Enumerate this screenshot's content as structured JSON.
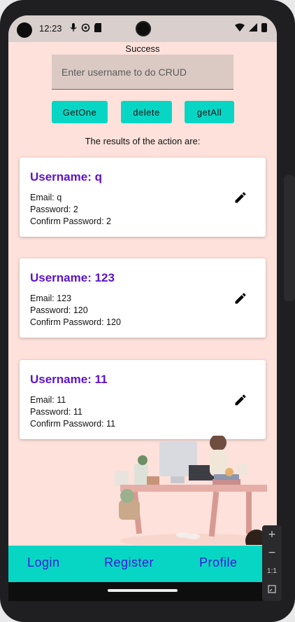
{
  "status_bar": {
    "time": "12:23"
  },
  "message": "Success",
  "search": {
    "placeholder": "Enter username to do CRUD",
    "value": ""
  },
  "actions": {
    "get_one": "GetOne",
    "delete": "delete",
    "get_all": "getAll"
  },
  "results_title": "The results of the action are:",
  "users": [
    {
      "username": "Username: q",
      "email": "Email: q",
      "password": "Password: 2",
      "confirm": "Confirm Password: 2"
    },
    {
      "username": "Username: 123",
      "email": "Email: 123",
      "password": "Password: 120",
      "confirm": "Confirm Password: 120"
    },
    {
      "username": "Username: 11",
      "email": "Email: 11",
      "password": "Password: 11",
      "confirm": "Confirm Password: 11"
    }
  ],
  "bottom_nav": {
    "login": "Login",
    "register": "Register",
    "profile": "Profile"
  },
  "zoom_controls": {
    "zoom_in": "+",
    "zoom_out": "−",
    "actual_size": "1:1"
  },
  "colors": {
    "accent": "#08d6c5",
    "username_text": "#5c12c9",
    "nav_text": "#3a16d8",
    "background": "#fde1da"
  },
  "icons": [
    "edit-icon",
    "wifi-icon",
    "signal-icon",
    "battery-icon"
  ]
}
